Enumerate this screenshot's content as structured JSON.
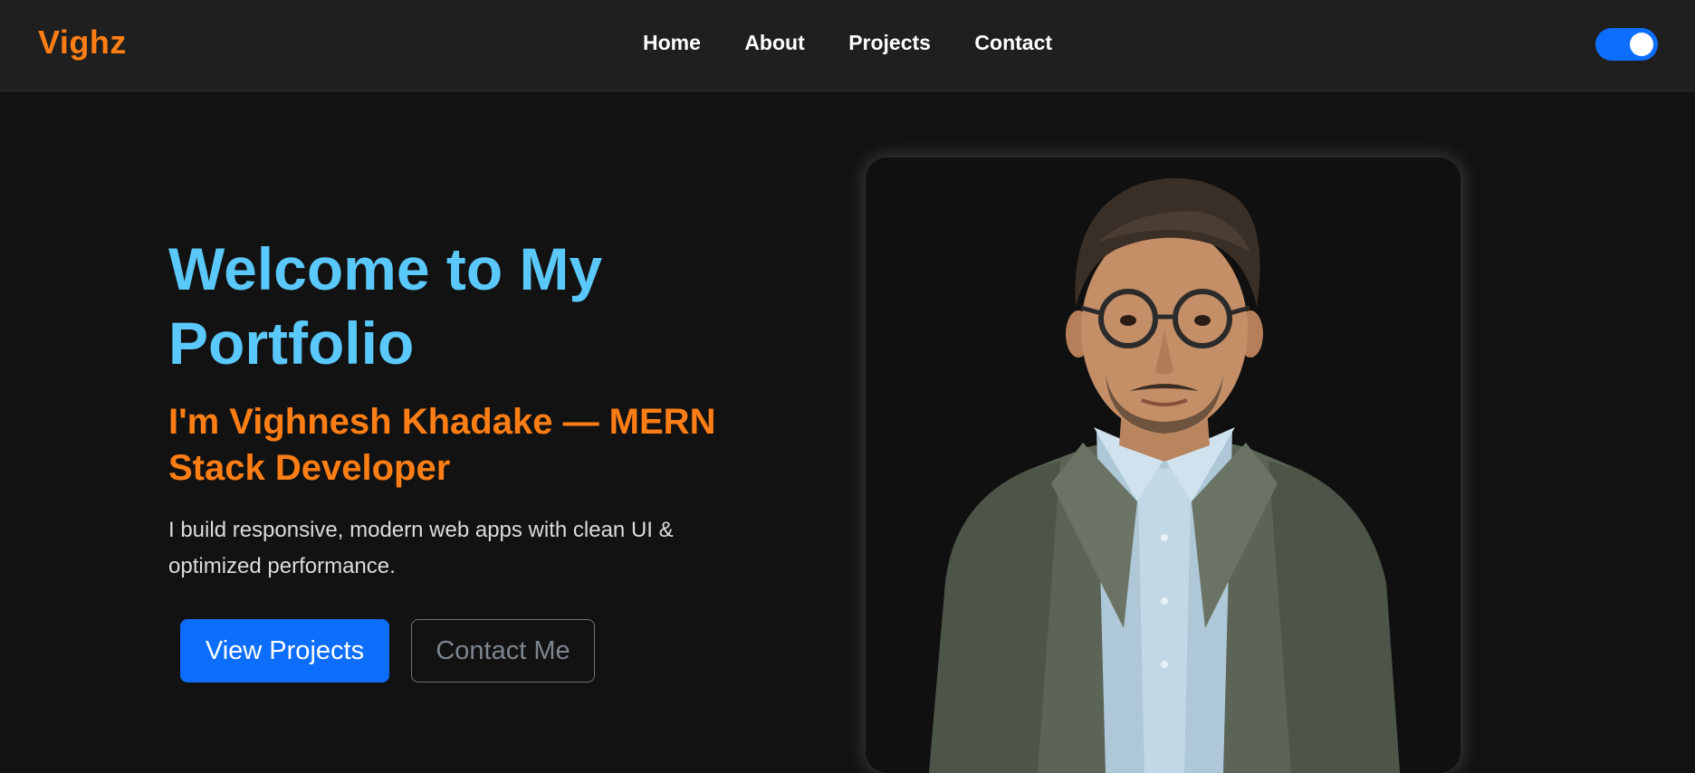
{
  "navbar": {
    "brand": "Vighz",
    "links": [
      "Home",
      "About",
      "Projects",
      "Contact"
    ],
    "theme_toggle": {
      "on": true,
      "color": "#0d6efd"
    }
  },
  "hero": {
    "title": "Welcome to My Portfolio",
    "subtitle": "I'm Vighnesh Khadake — MERN Stack Developer",
    "description": "I build responsive, modern web apps with clean UI & optimized performance.",
    "primary_button": "View Projects",
    "secondary_button": "Contact Me"
  },
  "colors": {
    "accent_orange": "#fd7e14",
    "accent_blue": "#5ac8fa",
    "button_blue": "#0d6efd",
    "background": "#121212",
    "navbar_bg": "#1f1f1f"
  },
  "profile_image": {
    "subject": "portrait-photo"
  }
}
